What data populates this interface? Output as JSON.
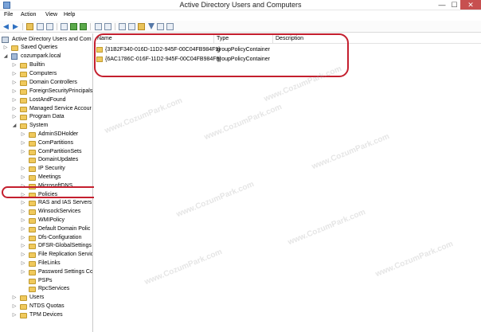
{
  "window": {
    "title": "Active Directory Users and Computers",
    "minimize": "—",
    "maximize": "☐",
    "close": "✕"
  },
  "menu": [
    "File",
    "Action",
    "View",
    "Help"
  ],
  "tree": {
    "root": "Active Directory Users and Com",
    "saved_queries": "Saved Queries",
    "domain": "cozumpark.local",
    "domain_children": [
      "Builtin",
      "Computers",
      "Domain Controllers",
      "ForeignSecurityPrincipals",
      "LostAndFound",
      "Managed Service Accour",
      "Program Data"
    ],
    "system": "System",
    "system_children": [
      "AdminSDHolder",
      "ComPartitions",
      "ComPartitionSets",
      "DomainUpdates",
      "IP Security",
      "Meetings",
      "MicrosoftDNS",
      "Policies",
      "RAS and IAS Servers A",
      "WinsockServices",
      "WMIPolicy",
      "Default Domain Polic",
      "Dfs-Configuration",
      "DFSR-GlobalSettings",
      "File Replication Servic",
      "FileLinks",
      "Password Settings Co",
      "PSPs",
      "RpcServices"
    ],
    "bottom_children": [
      "Users",
      "NTDS Quotas",
      "TPM Devices"
    ],
    "selected": "Policies"
  },
  "list": {
    "columns": [
      "Name",
      "Type",
      "Description"
    ],
    "rows": [
      {
        "name": "{31B2F340-016D-11D2-945F-00C04FB984F9}",
        "type": "groupPolicyContainer",
        "description": ""
      },
      {
        "name": "{6AC1786C-016F-11D2-945F-00C04FB984F9}",
        "type": "groupPolicyContainer",
        "description": ""
      }
    ]
  },
  "watermark": "www.CozumPark.com",
  "colors": {
    "annotation": "#c41f2e",
    "folder": "#f0c95c",
    "close_button": "#c75050"
  },
  "icons": [
    "back-arrow-icon",
    "forward-arrow-icon",
    "up-folder-icon",
    "console-tree-icon",
    "properties-icon",
    "refresh-icon",
    "export-icon",
    "help-icon",
    "add-user-icon",
    "add-group-icon",
    "new-ou-icon",
    "filter-icon",
    "add-to-group-icon",
    "delegate-icon"
  ]
}
